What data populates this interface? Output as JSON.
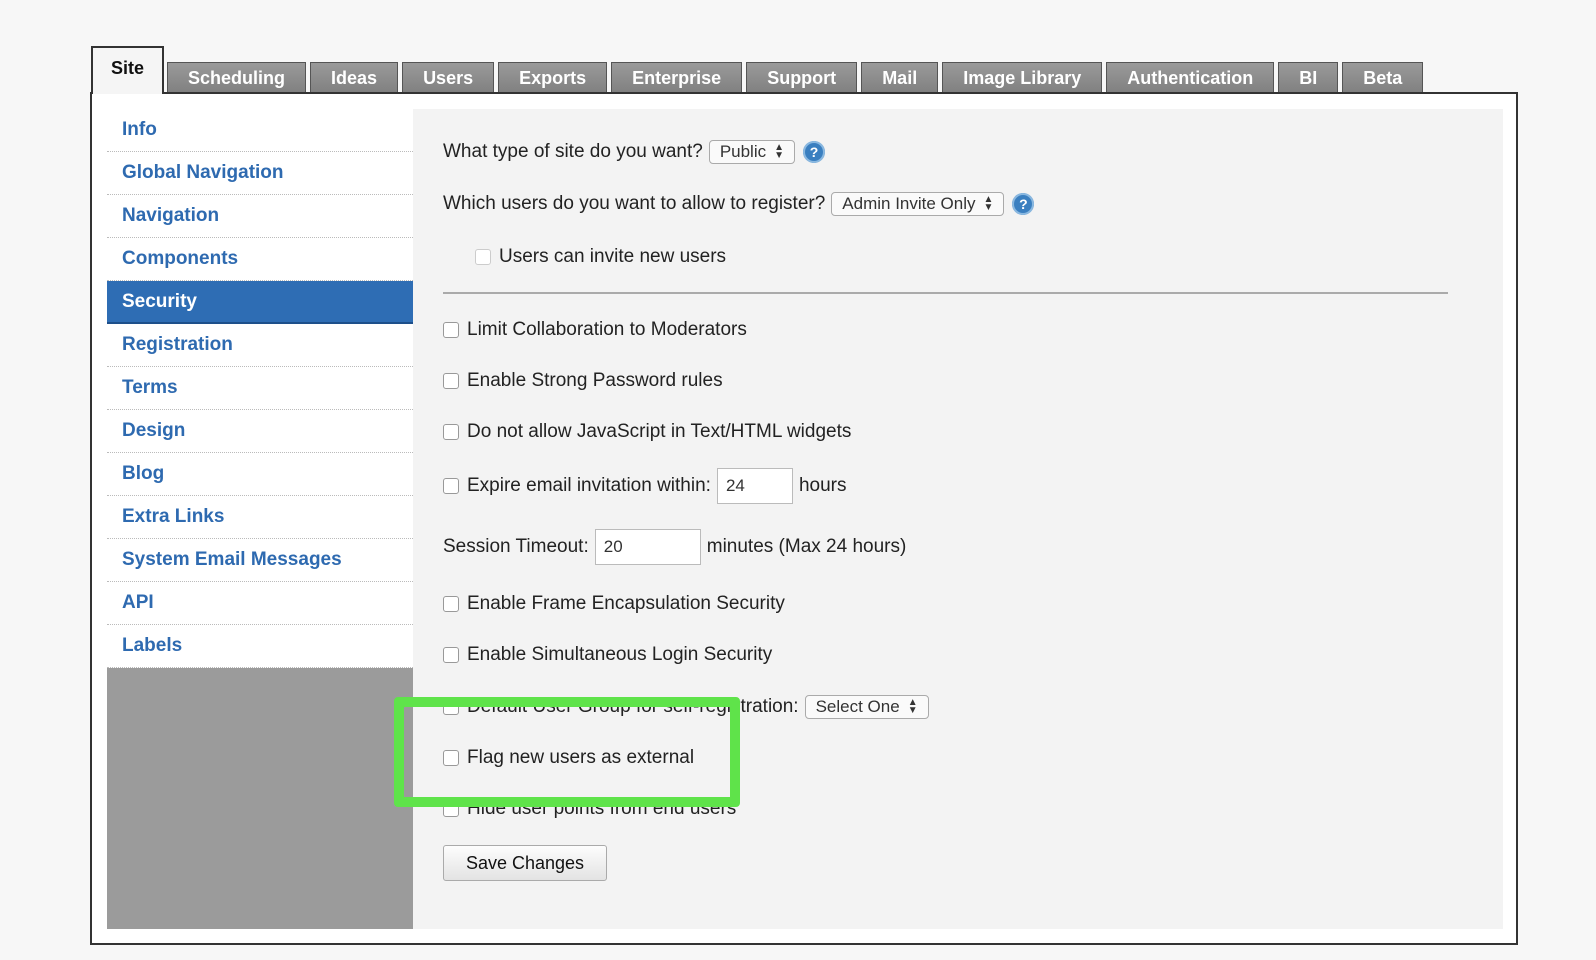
{
  "tabs": [
    "Site",
    "Scheduling",
    "Ideas",
    "Users",
    "Exports",
    "Enterprise",
    "Support",
    "Mail",
    "Image Library",
    "Authentication",
    "BI",
    "Beta"
  ],
  "sidebar": {
    "items": [
      "Info",
      "Global Navigation",
      "Navigation",
      "Components",
      "Security",
      "Registration",
      "Terms",
      "Design",
      "Blog",
      "Extra Links",
      "System Email Messages",
      "API",
      "Labels"
    ],
    "active": "Security"
  },
  "form": {
    "site_type_label": "What type of site do you want?",
    "site_type_value": "Public",
    "register_label": "Which users do you want to allow to register?",
    "register_value": "Admin Invite Only",
    "invite_label": "Users can invite new users",
    "limit_collab_label": "Limit Collaboration to Moderators",
    "strong_password_label": "Enable Strong Password rules",
    "no_js_label": "Do not allow JavaScript in Text/HTML widgets",
    "expire_label": "Expire email invitation within:",
    "expire_value": "24",
    "expire_unit": "hours",
    "session_label": "Session Timeout:",
    "session_value": "20",
    "session_unit": "minutes (Max 24 hours)",
    "frame_label": "Enable Frame Encapsulation Security",
    "simul_label": "Enable Simultaneous Login Security",
    "default_group_label": "Default User Group for self-registration:",
    "default_group_value": "Select One",
    "flag_external_label": "Flag new users as external",
    "hide_points_label": "Hide user points from end users",
    "save_label": "Save Changes",
    "help_glyph": "?"
  },
  "colors": {
    "accent": "#2e6db4",
    "highlight": "#5fe34a"
  }
}
